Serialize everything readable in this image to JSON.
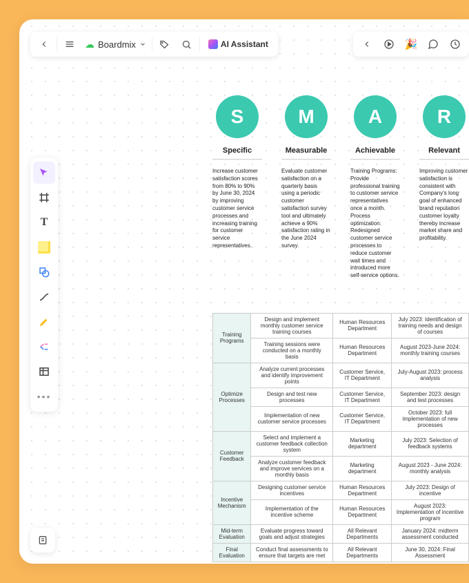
{
  "colors": {
    "accent": "#3BC9B0",
    "bg": "#F9B759"
  },
  "topbar": {
    "brand": "Boardmix",
    "ai": "AI Assistant"
  },
  "smart": [
    {
      "letter": "S",
      "label": "Specific",
      "desc": "Increase customer satisfaction scores from 80% to 90% by June 30, 2024 by improving customer service processes and increasing training for customer service representatives."
    },
    {
      "letter": "M",
      "label": "Measurable",
      "desc": "Evaluate customer satisfaction on a quarterly basis using a periodic customer satisfaction survey tool and ultimately achieve a 90% satisfaction rating in the June 2024 survey."
    },
    {
      "letter": "A",
      "label": "Achievable",
      "desc": "Training Programs: Provide professional training to customer service representatives once a month. Process optimization: Redesigned customer service processes to reduce customer wait times and introduced more self-service options."
    },
    {
      "letter": "R",
      "label": "Relevant",
      "desc": "Improving customer satisfaction is consistent with Company's long goal of enhanced brand reputation customer loyalty thereby increase market share and profitability."
    }
  ],
  "table": {
    "rows": [
      {
        "cat": "Training Programs",
        "span": 2,
        "items": [
          {
            "task": "Design and implement monthly customer service training courses",
            "dept": "Human Resources Department",
            "time": "July 2023: Identification of training needs and design of courses"
          },
          {
            "task": "Training sessions were conducted on a monthly basis",
            "dept": "Human Resources Department",
            "time": "August 2023-June 2024: monthly training courses"
          }
        ]
      },
      {
        "cat": "Optimize Processes",
        "span": 3,
        "items": [
          {
            "task": "Analyze current processes and identify improvement points",
            "dept": "Customer Service, IT Department",
            "time": "July-August 2023: process analysis"
          },
          {
            "task": "Design and test new processes",
            "dept": "Customer Service, IT Department",
            "time": "September 2023: design and test processes"
          },
          {
            "task": "Implementation of new customer service processes",
            "dept": "Customer Service, IT Department",
            "time": "October 2023: full implementation of new processes"
          }
        ]
      },
      {
        "cat": "Customer Feedback",
        "span": 2,
        "items": [
          {
            "task": "Select and implement a customer feedback collection system",
            "dept": "Marketing department",
            "time": "July 2023: Selection of feedback systems"
          },
          {
            "task": "Analyze customer feedback and improve services on a monthly basis",
            "dept": "Marketing department",
            "time": "August 2023 - June 2024: monthly analysis"
          }
        ]
      },
      {
        "cat": "Incentive Mechanism",
        "span": 2,
        "items": [
          {
            "task": "Designing customer service incentives",
            "dept": "Human Resources Department",
            "time": "July 2023: Design of incentive"
          },
          {
            "task": "Implementation of the incentive scheme",
            "dept": "Human Resources Department",
            "time": "August 2023: Implementation of incentive program"
          }
        ]
      },
      {
        "cat": "Mid-term Evaluation",
        "span": 1,
        "items": [
          {
            "task": "Evaluate progress toward goals and adjust strategies",
            "dept": "All Relevant Departments",
            "time": "January 2024: midterm assessment conducted"
          }
        ]
      },
      {
        "cat": "Final Evaluation",
        "span": 1,
        "items": [
          {
            "task": "Conduct final assessments to ensure that targets are met",
            "dept": "All Relevant Departments",
            "time": "June 30, 2024: Final Assessment"
          }
        ]
      }
    ]
  }
}
